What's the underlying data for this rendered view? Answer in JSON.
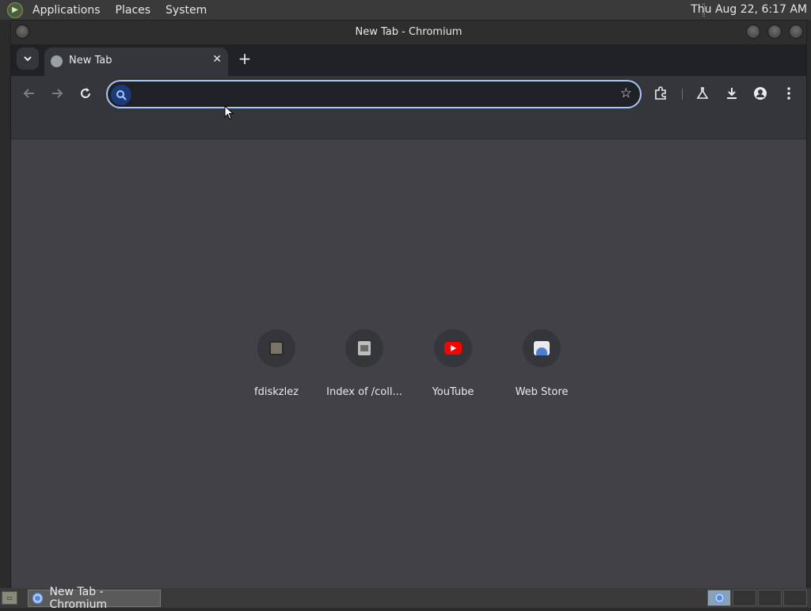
{
  "top_panel": {
    "menus": [
      "Applications",
      "Places",
      "System"
    ],
    "clock": "Thu Aug 22,  6:17 AM"
  },
  "window": {
    "title": "New Tab - Chromium"
  },
  "tabs": [
    {
      "label": "New Tab",
      "favicon": "globe-icon",
      "active": true
    }
  ],
  "toolbar": {
    "omnibox_value": "",
    "icons": [
      "back-icon",
      "forward-icon",
      "reload-icon",
      "star-icon",
      "extensions-icon",
      "labs-icon",
      "download-icon",
      "profile-icon",
      "menu-icon"
    ]
  },
  "shortcuts": [
    {
      "label": "fdiskzlez",
      "icon": "avatar-icon"
    },
    {
      "label": "Index of /coll...",
      "icon": "document-icon"
    },
    {
      "label": "YouTube",
      "icon": "youtube-icon"
    },
    {
      "label": "Web Store",
      "icon": "webstore-icon"
    }
  ],
  "taskbar": {
    "items": [
      {
        "label": "New Tab - Chromium",
        "icon": "chromium-icon"
      }
    ]
  },
  "colors": {
    "content_bg": "#424246",
    "toolbar_bg": "#35363a",
    "tabstrip_bg": "#202124",
    "omnibox_focus": "#a8c7fa"
  }
}
